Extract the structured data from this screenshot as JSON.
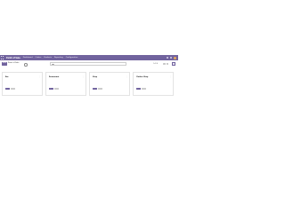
{
  "navbar": {
    "brand": "Point of Sale",
    "menu": [
      "Dashboard",
      "Orders",
      "Products",
      "Reporting",
      "Configuration"
    ],
    "accent": "#71639e"
  },
  "control": {
    "new_label": "New",
    "breadcrumb": "Point of Sale",
    "search_placeholder": "Search...",
    "pager": "1-4 / 4",
    "prev": "‹",
    "next": "›"
  },
  "cards": [
    {
      "title": "Bar",
      "subtitle": "",
      "note": "",
      "primary": "Open",
      "secondary": "",
      "stats": [
        {
          "label": "",
          "value": ""
        },
        {
          "label": "",
          "value": ""
        },
        {
          "label": "",
          "value": ""
        }
      ]
    },
    {
      "title": "Restaurant",
      "subtitle": "",
      "note": "",
      "primary": "Open",
      "secondary": "",
      "stats": [
        {
          "label": "",
          "value": ""
        },
        {
          "label": "",
          "value": ""
        },
        {
          "label": "",
          "value": ""
        }
      ]
    },
    {
      "title": "Shop",
      "subtitle": "",
      "note": "",
      "primary": "Open",
      "secondary": "",
      "stats": [
        {
          "label": "",
          "value": ""
        },
        {
          "label": "",
          "value": ""
        },
        {
          "label": "",
          "value": ""
        }
      ]
    },
    {
      "title": "Clothes Shop",
      "subtitle": "",
      "note": "",
      "primary": "Open",
      "secondary": "",
      "stats": [
        {
          "label": "",
          "value": ""
        },
        {
          "label": "",
          "value": ""
        },
        {
          "label": "",
          "value": ""
        }
      ]
    }
  ]
}
